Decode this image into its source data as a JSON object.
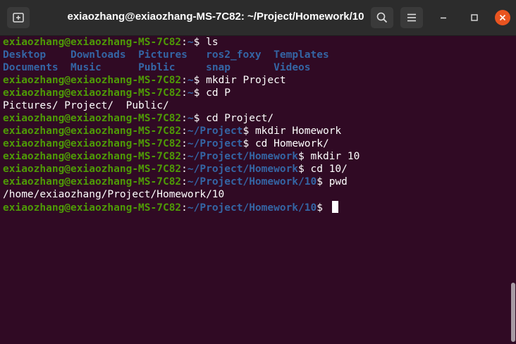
{
  "window": {
    "title": "exiaozhang@exiaozhang-MS-7C82: ~/Project/Homework/10"
  },
  "colors": {
    "background": "#300a24",
    "user_host": "#4e9a06",
    "path": "#3465a4",
    "text": "#ffffff",
    "close_button": "#e95420"
  },
  "icons": {
    "new_tab": "new-tab-icon",
    "search": "search-icon",
    "menu": "hamburger-menu-icon",
    "minimize": "minimize-icon",
    "maximize": "maximize-icon",
    "close": "close-icon"
  },
  "terminal": {
    "prompt_user": "exiaozhang@exiaozhang-MS-7C82",
    "lines": [
      {
        "path": "~",
        "cmd": " ls"
      },
      {
        "ls_row": [
          "Desktop    ",
          "Downloads  ",
          "Pictures   ",
          "ros2_foxy  ",
          "Templates"
        ]
      },
      {
        "ls_row": [
          "Documents  ",
          "Music      ",
          "Public     ",
          "snap       ",
          "Videos"
        ]
      },
      {
        "path": "~",
        "cmd": " mkdir Project"
      },
      {
        "path": "~",
        "cmd": " cd P"
      },
      {
        "text": "Pictures/ Project/  Public/"
      },
      {
        "path": "~",
        "cmd": " cd Project/"
      },
      {
        "path": "~/Project",
        "cmd": " mkdir Homework"
      },
      {
        "path": "~/Project",
        "cmd": " cd Homework/"
      },
      {
        "path": "~/Project/Homework",
        "cmd": " mkdir 10"
      },
      {
        "path": "~/Project/Homework",
        "cmd": " cd 10/"
      },
      {
        "path": "~/Project/Homework/10",
        "cmd": " pwd"
      },
      {
        "text": "/home/exiaozhang/Project/Homework/10"
      },
      {
        "path": "~/Project/Homework/10",
        "cmd": " ",
        "cursor": true
      }
    ]
  }
}
